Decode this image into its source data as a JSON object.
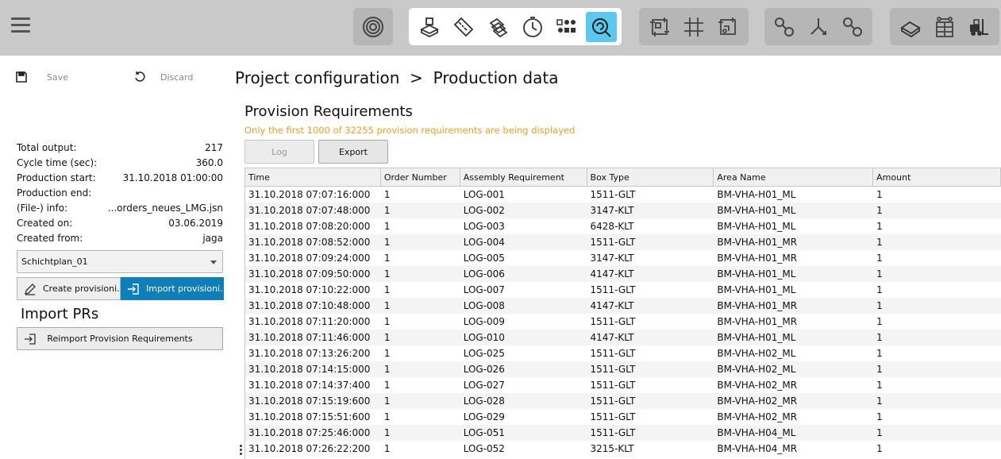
{
  "toolbar": {
    "groups": [
      {
        "items": [
          {
            "icon": "target-icon"
          }
        ]
      },
      {
        "items": [
          {
            "icon": "boxes-icon"
          },
          {
            "icon": "ruler-icon"
          },
          {
            "icon": "layers-icon"
          },
          {
            "icon": "clock-icon"
          },
          {
            "icon": "grid-dots-icon"
          },
          {
            "icon": "search-cycle-icon",
            "active": true
          }
        ]
      },
      {
        "items": [
          {
            "icon": "frame-icon"
          },
          {
            "icon": "hash-grid-icon"
          },
          {
            "icon": "path-frame-icon"
          }
        ]
      },
      {
        "items": [
          {
            "icon": "chain-link-icon"
          },
          {
            "icon": "branch-icon"
          },
          {
            "icon": "chain-link-2-icon"
          }
        ]
      },
      {
        "items": [
          {
            "icon": "conveyor-icon"
          },
          {
            "icon": "shelf-icon"
          },
          {
            "icon": "forklift-icon"
          }
        ]
      }
    ],
    "accent_color": "#5bc8f0"
  },
  "sidebar": {
    "save_label": "Save",
    "discard_label": "Discard",
    "info": [
      {
        "label": "Total output:",
        "value": "217"
      },
      {
        "label": "Cycle time (sec):",
        "value": "360.0"
      },
      {
        "label": "Production start:",
        "value": "31.10.2018 01:00:00"
      },
      {
        "label": "Production end:",
        "value": ""
      },
      {
        "label": "(File-) info:",
        "value": "...orders_neues_LMG.jsn"
      },
      {
        "label": "Created on:",
        "value": "03.06.2019"
      },
      {
        "label": "Created from:",
        "value": "jaga"
      }
    ],
    "select_value": "Schichtplan_01",
    "create_label": "Create provisioni...",
    "import_label": "Import provisioni...",
    "import_title": "Import PRs",
    "reimport_label": "Reimport Provision Requirements"
  },
  "main": {
    "breadcrumb": "Project configuration  >  Production data",
    "title": "Provision Requirements",
    "warning": "Only the first 1000 of 32255 provision requirements are being displayed",
    "warning_color": "#f0a020",
    "log_label": "Log",
    "export_label": "Export"
  },
  "table": {
    "columns": [
      "Time",
      "Order Number",
      "Assembly Requirement",
      "Box Type",
      "Area Name",
      "Amount"
    ],
    "rows": [
      [
        "31.10.2018 07:07:16:000",
        "1",
        "LOG-001",
        "1511-GLT",
        "BM-VHA-H01_ML",
        "1"
      ],
      [
        "31.10.2018 07:07:48:000",
        "1",
        "LOG-002",
        "3147-KLT",
        "BM-VHA-H01_ML",
        "1"
      ],
      [
        "31.10.2018 07:08:20:000",
        "1",
        "LOG-003",
        "6428-KLT",
        "BM-VHA-H01_ML",
        "1"
      ],
      [
        "31.10.2018 07:08:52:000",
        "1",
        "LOG-004",
        "1511-GLT",
        "BM-VHA-H01_MR",
        "1"
      ],
      [
        "31.10.2018 07:09:24:000",
        "1",
        "LOG-005",
        "3147-KLT",
        "BM-VHA-H01_MR",
        "1"
      ],
      [
        "31.10.2018 07:09:50:000",
        "1",
        "LOG-006",
        "4147-KLT",
        "BM-VHA-H01_ML",
        "1"
      ],
      [
        "31.10.2018 07:10:22:000",
        "1",
        "LOG-007",
        "1511-GLT",
        "BM-VHA-H01_ML",
        "1"
      ],
      [
        "31.10.2018 07:10:48:000",
        "1",
        "LOG-008",
        "4147-KLT",
        "BM-VHA-H01_MR",
        "1"
      ],
      [
        "31.10.2018 07:11:20:000",
        "1",
        "LOG-009",
        "1511-GLT",
        "BM-VHA-H01_MR",
        "1"
      ],
      [
        "31.10.2018 07:11:46:000",
        "1",
        "LOG-010",
        "4147-KLT",
        "BM-VHA-H01_ML",
        "1"
      ],
      [
        "31.10.2018 07:13:26:200",
        "1",
        "LOG-025",
        "1511-GLT",
        "BM-VHA-H02_ML",
        "1"
      ],
      [
        "31.10.2018 07:14:15:000",
        "1",
        "LOG-026",
        "1511-GLT",
        "BM-VHA-H02_ML",
        "1"
      ],
      [
        "31.10.2018 07:14:37:400",
        "1",
        "LOG-027",
        "1511-GLT",
        "BM-VHA-H02_MR",
        "1"
      ],
      [
        "31.10.2018 07:15:19:600",
        "1",
        "LOG-028",
        "1511-GLT",
        "BM-VHA-H02_MR",
        "1"
      ],
      [
        "31.10.2018 07:15:51:600",
        "1",
        "LOG-029",
        "1511-GLT",
        "BM-VHA-H02_MR",
        "1"
      ],
      [
        "31.10.2018 07:25:46:000",
        "1",
        "LOG-051",
        "1511-GLT",
        "BM-VHA-H04_ML",
        "1"
      ],
      [
        "31.10.2018 07:26:22:200",
        "1",
        "LOG-052",
        "3215-KLT",
        "BM-VHA-H04_MR",
        "1"
      ]
    ]
  }
}
